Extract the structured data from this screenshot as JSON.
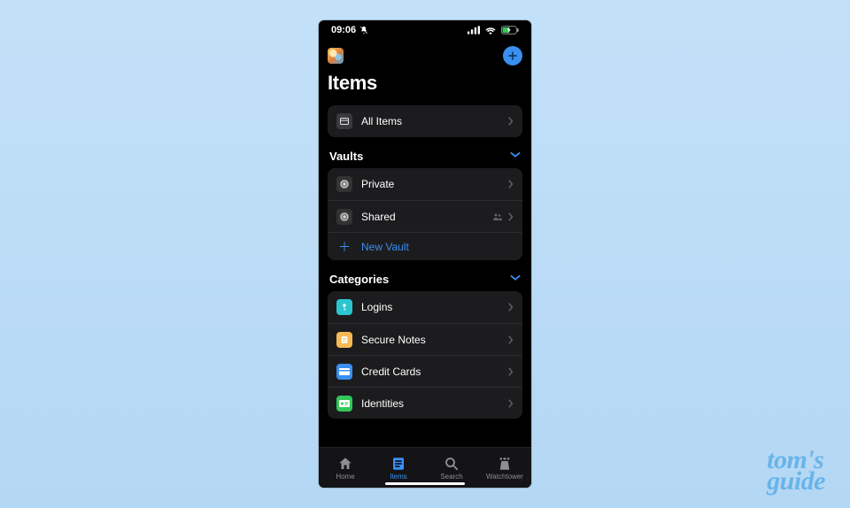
{
  "status": {
    "time": "09:06"
  },
  "header": {
    "title": "Items"
  },
  "all_items": {
    "label": "All Items"
  },
  "sections": {
    "vaults": {
      "title": "Vaults",
      "items": [
        {
          "label": "Private"
        },
        {
          "label": "Shared"
        }
      ],
      "new_label": "New Vault"
    },
    "categories": {
      "title": "Categories",
      "items": [
        {
          "label": "Logins"
        },
        {
          "label": "Secure Notes"
        },
        {
          "label": "Credit Cards"
        },
        {
          "label": "Identities"
        }
      ]
    }
  },
  "tabs": {
    "home": "Home",
    "items": "Items",
    "search": "Search",
    "watchtower": "Watchtower"
  },
  "watermark": {
    "line1": "tom's",
    "line2": "guide"
  }
}
